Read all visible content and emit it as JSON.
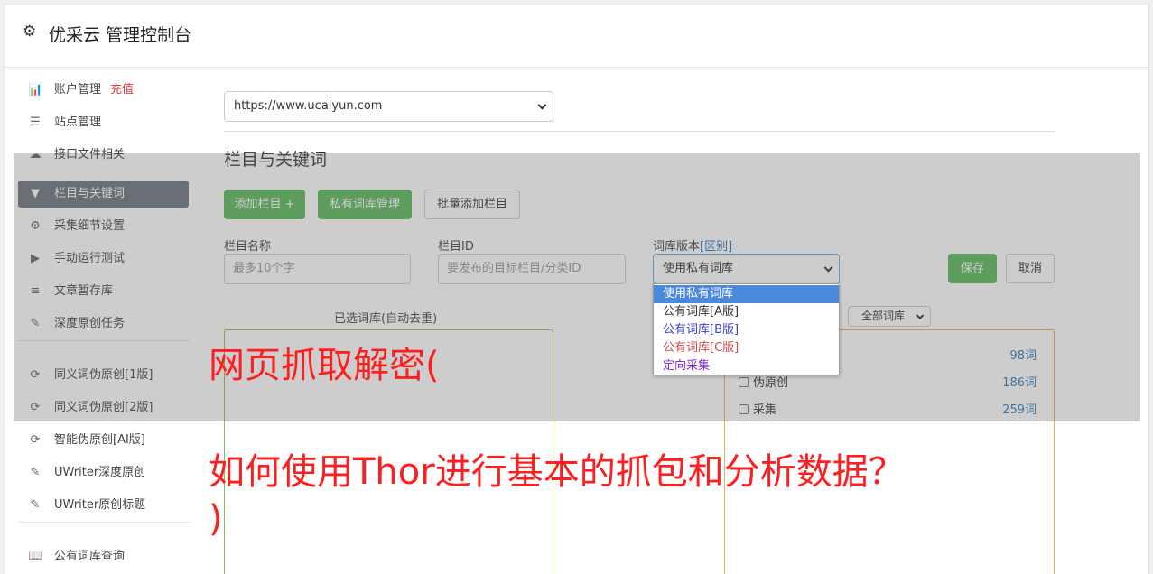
{
  "header": {
    "title": "优采云 管理控制台",
    "icon": "gear-icon"
  },
  "sidebar": {
    "items": [
      {
        "name": "account",
        "label": "账户管理",
        "badge": "充值",
        "icon": "bar-chart-icon",
        "glyph": "📊"
      },
      {
        "name": "sites",
        "label": "站点管理",
        "icon": "server-icon",
        "glyph": "☰"
      },
      {
        "name": "api-files",
        "label": "接口文件相关",
        "icon": "cloud-upload-icon",
        "glyph": "☁"
      },
      {
        "name": "columns-keywords",
        "label": "栏目与关键词",
        "icon": "filter-icon",
        "glyph": "▼",
        "active": true
      },
      {
        "name": "collect-settings",
        "label": "采集细节设置",
        "icon": "cogs-icon",
        "glyph": "⚙"
      },
      {
        "name": "manual-run",
        "label": "手动运行测试",
        "icon": "play-icon",
        "glyph": "▶"
      },
      {
        "name": "article-store",
        "label": "文章暂存库",
        "icon": "database-icon",
        "glyph": "≡"
      },
      {
        "name": "deep-original",
        "label": "深度原创任务",
        "icon": "edit-icon",
        "glyph": "✎"
      },
      {
        "name": "synonym-v1",
        "label": "同义词伪原创[1版]",
        "icon": "refresh-icon",
        "glyph": "⟳"
      },
      {
        "name": "synonym-v2",
        "label": "同义词伪原创[2版]",
        "icon": "refresh-icon",
        "glyph": "⟳"
      },
      {
        "name": "ai-original",
        "label": "智能伪原创[AI版]",
        "icon": "refresh-icon",
        "glyph": "⟳"
      },
      {
        "name": "uwriter-deep",
        "label": "UWriter深度原创",
        "icon": "edit-icon",
        "glyph": "✎"
      },
      {
        "name": "uwriter-title",
        "label": "UWriter原创标题",
        "icon": "edit-icon",
        "glyph": "✎"
      },
      {
        "name": "public-lexicon",
        "label": "公有词库查询",
        "icon": "book-icon",
        "glyph": "📖"
      }
    ]
  },
  "main": {
    "site_select": "https://www.ucaiyun.com",
    "section_title": "栏目与关键词",
    "buttons": {
      "add_column": "添加栏目 +",
      "private_lexicon": "私有词库管理",
      "batch_add": "批量添加栏目",
      "save": "保存",
      "cancel": "取消"
    },
    "fields": {
      "column_name": {
        "label": "栏目名称",
        "placeholder": "最多10个字"
      },
      "column_id": {
        "label": "栏目ID",
        "placeholder": "要发布的目标栏目/分类ID"
      },
      "lexicon_version": {
        "label": "词库版本",
        "label_link": "[区别]",
        "value": "使用私有词库"
      }
    },
    "dropdown_options": [
      {
        "label": "使用私有词库",
        "color": "#ffffff",
        "selected": true
      },
      {
        "label": "公有词库[A版]",
        "color": "#333333"
      },
      {
        "label": "公有词库[B版]",
        "color": "#3c3cd0"
      },
      {
        "label": "公有词库[C版]",
        "color": "#d04a4a"
      },
      {
        "label": "定向采集",
        "color": "#8a2be2"
      }
    ],
    "selected_lexicon_title": "已选词库(自动去重)",
    "all_lexicon_select": "全部词库",
    "lexicon_list": [
      {
        "label": "",
        "count": "98词"
      },
      {
        "label": "伪原创",
        "count": "186词"
      },
      {
        "label": "采集",
        "count": "259词"
      }
    ]
  },
  "overlay_text": {
    "line1": "网页抓取解密(",
    "line2": "如何使用Thor进行基本的抓包和分析数据？",
    "line3": ")"
  }
}
